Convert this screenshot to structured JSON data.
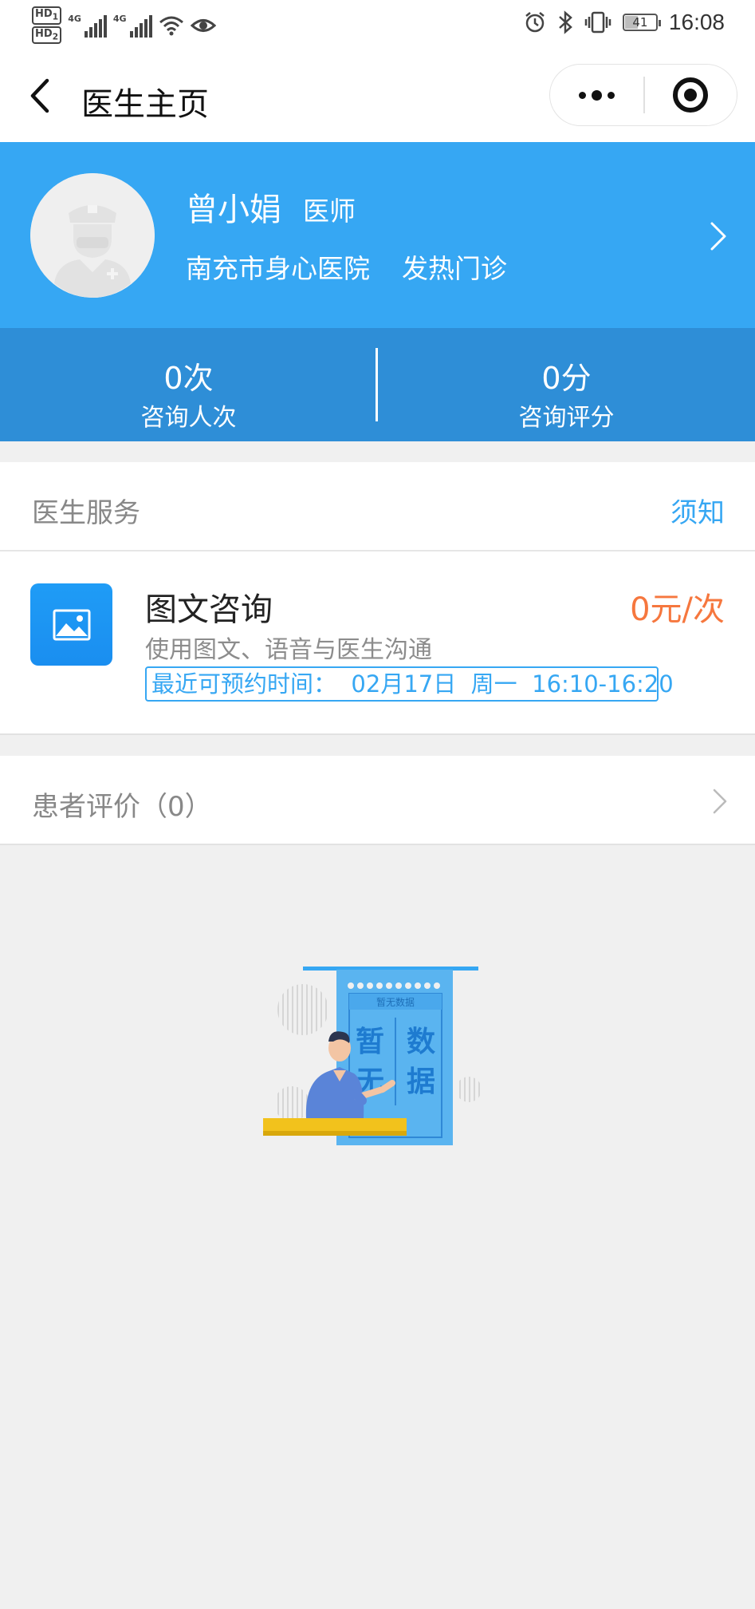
{
  "status_bar": {
    "hd1": "HD",
    "hd1_sub": "1",
    "hd2": "HD",
    "hd2_sub": "2",
    "net1": "4G",
    "net2": "4G",
    "battery": "41",
    "time": "16:08",
    "icons": [
      "signal-icon",
      "wifi-icon",
      "eye-icon",
      "alarm-icon",
      "bluetooth-icon",
      "vibrate-icon",
      "battery-icon"
    ]
  },
  "nav": {
    "title": "医生主页",
    "back_icon": "chevron-left-icon",
    "more_icon": "more-icon",
    "close_icon": "target-icon"
  },
  "doctor": {
    "name": "曾小娟",
    "title": "医师",
    "hospital": "南充市身心医院",
    "department": "发热门诊",
    "avatar_icon": "doctor-avatar-icon"
  },
  "stats": [
    {
      "value": "0次",
      "label": "咨询人次"
    },
    {
      "value": "0分",
      "label": "咨询评分"
    }
  ],
  "services": {
    "title": "医生服务",
    "notice_link": "须知",
    "items": [
      {
        "name": "图文咨询",
        "price": "0元/次",
        "description": "使用图文、语音与医生沟通",
        "time": "最近可预约时间：  02月17日  周一  16:10-16:20",
        "icon": "image-icon"
      }
    ]
  },
  "reviews": {
    "label": "患者评价（0）"
  },
  "empty_state": {
    "illustration_icon": "no-data-illustration",
    "banner_small": "暂无数据",
    "big_chars": [
      "暂",
      "数",
      "无",
      "据"
    ]
  },
  "colors": {
    "primary": "#36a7f3",
    "stats_bg": "#2e8ed7",
    "price": "#f6773e",
    "page_bg": "#f0f0f0"
  }
}
